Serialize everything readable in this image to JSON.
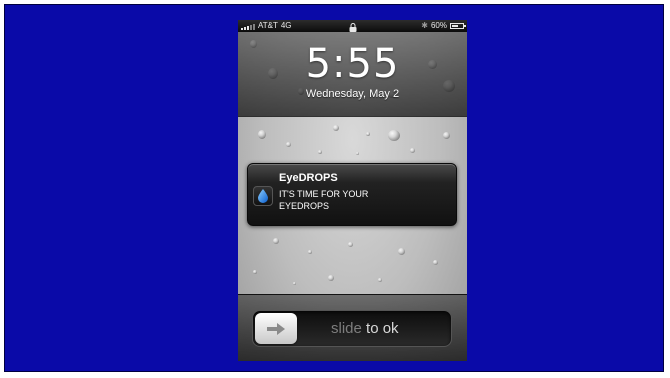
{
  "status_bar": {
    "carrier": "AT&T",
    "network": "4G",
    "battery_text": "60%",
    "battery_level": 0.6,
    "icons": [
      "signal-bars-icon",
      "lock-icon",
      "bluetooth-icon",
      "battery-icon"
    ]
  },
  "lock_screen": {
    "time": "5:55",
    "date": "Wednesday, May 2"
  },
  "notification": {
    "app_name": "EyeDROPS",
    "message": "IT'S TIME FOR YOUR EYEDROPS",
    "icon": "water-drop-icon"
  },
  "slider": {
    "label_prefix": "slide",
    "label_to": "to",
    "label_action": "ok",
    "icon": "arrow-right-icon"
  },
  "colors": {
    "background": "#0a0aa8",
    "notification_bg": "#1a1a1a",
    "drop_icon": "#1e90ff"
  }
}
